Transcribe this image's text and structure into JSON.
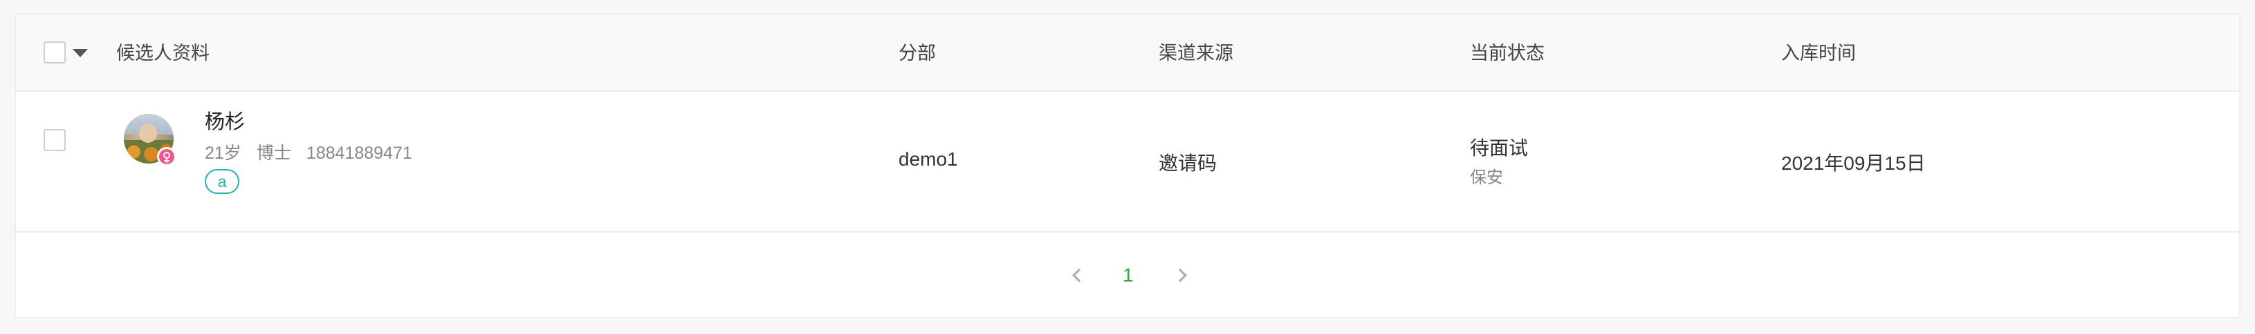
{
  "table": {
    "columns": {
      "profile": "候选人资料",
      "branch": "分部",
      "channel": "渠道来源",
      "status": "当前状态",
      "entry_time": "入库时间"
    },
    "rows": [
      {
        "name": "杨杉",
        "age": "21岁",
        "degree": "博士",
        "phone": "18841889471",
        "tag": "a",
        "gender": "female",
        "branch": "demo1",
        "channel": "邀请码",
        "status": "待面试",
        "position": "保安",
        "entry_time": "2021年09月15日"
      }
    ]
  },
  "pagination": {
    "current_page": "1"
  },
  "colors": {
    "accent_teal": "#21b3b3",
    "page_active_green": "#3aa53a",
    "female_badge": "#f0568c"
  },
  "icons": {
    "select_all_dropdown": "caret-down-icon",
    "prev": "chevron-left-icon",
    "next": "chevron-right-icon",
    "gender": "female-icon"
  }
}
